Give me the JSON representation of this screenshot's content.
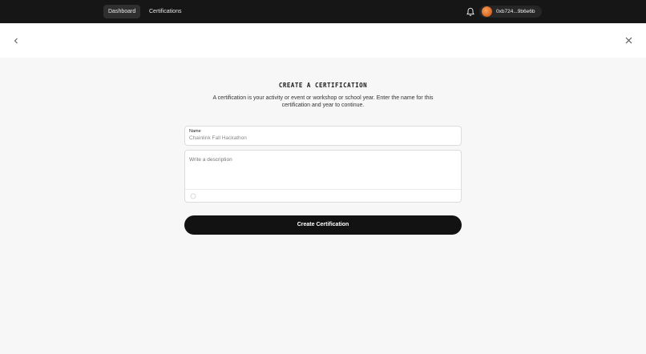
{
  "nav": {
    "tabs": [
      {
        "label": "Dashboard",
        "active": true
      },
      {
        "label": "Certifications",
        "active": false
      }
    ],
    "notifications_icon": "bell-icon",
    "account": {
      "address": "0xb724...9b6e6b",
      "avatar_icon": "avatar"
    }
  },
  "header": {
    "back_icon": "chevron-left-icon",
    "close_icon": "close-icon"
  },
  "form": {
    "title": "CREATE A CERTIFICATION",
    "description": "A certification is your activity or event or workshop or school year. Enter the name for this certification and year to continue.",
    "name_label": "Name",
    "name_value": "Chainlink Fall Hackathon",
    "description_placeholder": "Write a description",
    "attachment_icon": "circle-icon",
    "submit_label": "Create Certification"
  },
  "colors": {
    "topbar": "#161616",
    "button": "#121212",
    "background": "#f7f7f7"
  }
}
